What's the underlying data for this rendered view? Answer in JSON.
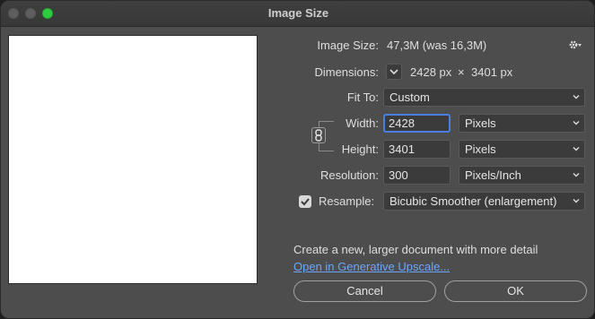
{
  "window": {
    "title": "Image Size"
  },
  "image_size": {
    "label": "Image Size:",
    "value": "47,3M (was 16,3M)"
  },
  "dimensions": {
    "label": "Dimensions:",
    "width": "2428 px",
    "times": "×",
    "height": "3401 px"
  },
  "fit_to": {
    "label": "Fit To:",
    "selected": "Custom"
  },
  "width": {
    "label": "Width:",
    "value": "2428",
    "unit": "Pixels"
  },
  "height": {
    "label": "Height:",
    "value": "3401",
    "unit": "Pixels"
  },
  "resolution": {
    "label": "Resolution:",
    "value": "300",
    "unit": "Pixels/Inch"
  },
  "resample": {
    "label": "Resample:",
    "checked": true,
    "method": "Bicubic Smoother (enlargement)"
  },
  "info": {
    "description": "Create a new, larger document with more detail",
    "link": "Open in Generative Upscale..."
  },
  "buttons": {
    "cancel": "Cancel",
    "ok": "OK"
  },
  "icons": [
    "gear-icon",
    "chevron-down-icon",
    "chain-link-icon",
    "checkmark-icon"
  ],
  "colors": {
    "focus": "#4a7fe0",
    "link": "#6aa6ff",
    "zoom": "#2ecc40"
  }
}
